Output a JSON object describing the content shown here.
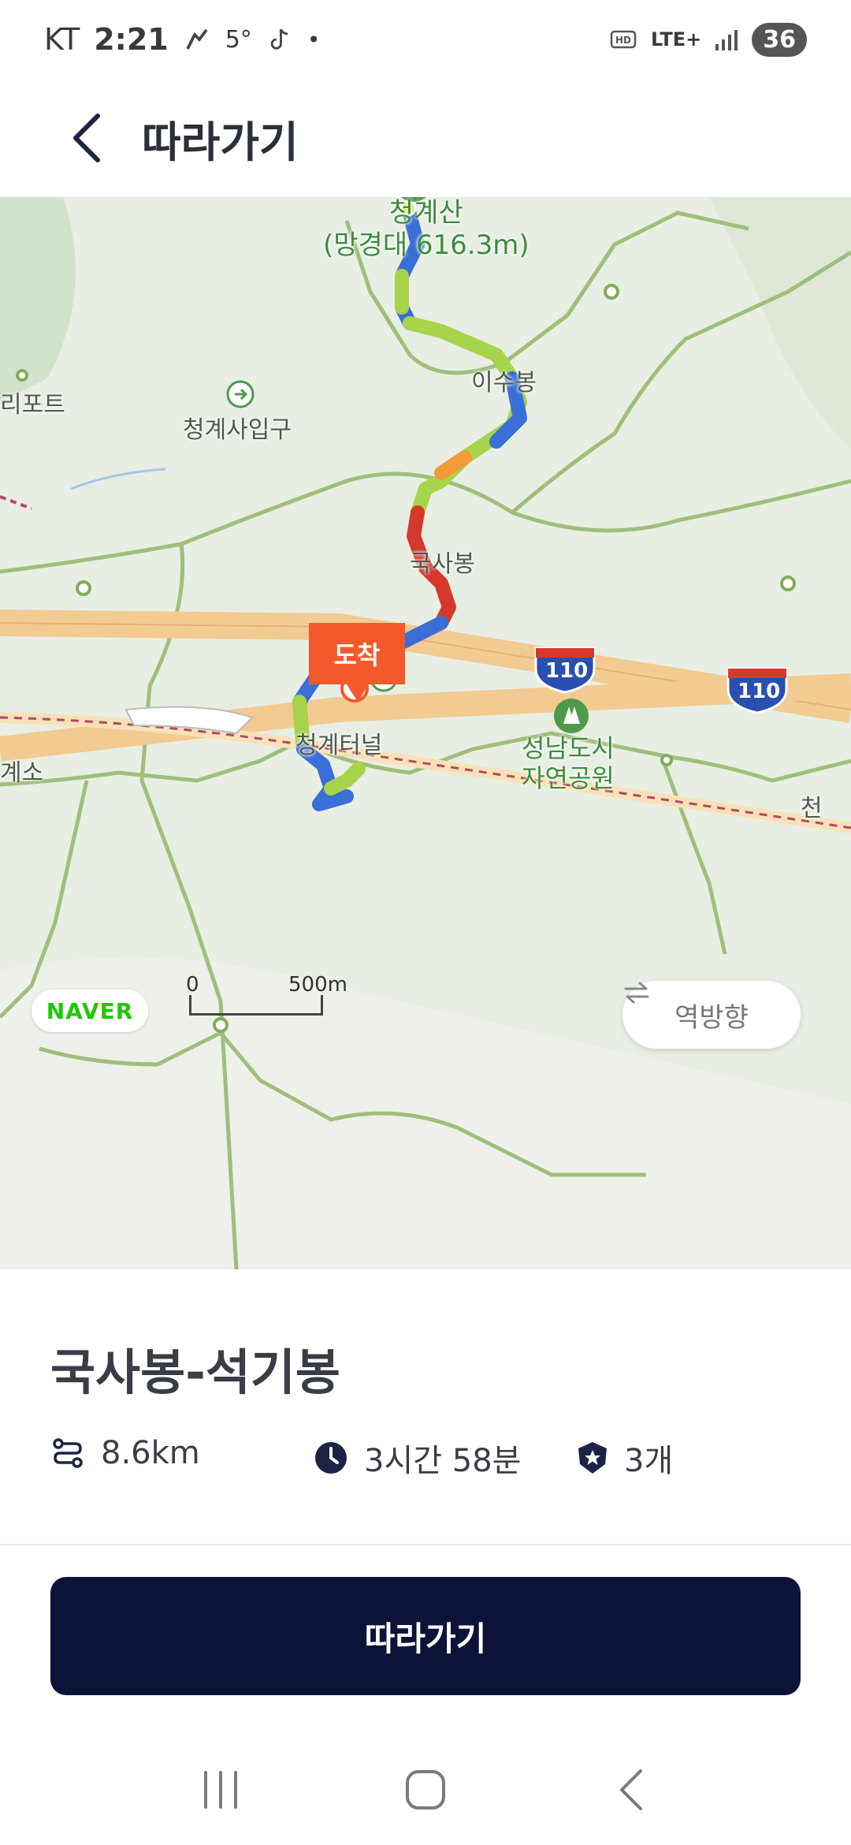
{
  "status_bar": {
    "carrier": "KT",
    "time": "2:21",
    "temperature": "5°",
    "network": "LTE+",
    "battery": "36"
  },
  "header": {
    "title": "따라가기"
  },
  "map": {
    "peak_label_line1": "청계산",
    "peak_label_line2": "(망경대 616.3m)",
    "labels": {
      "resort": "리포트",
      "cheonggyesa": "청계사입구",
      "isubong": "이수봉",
      "guksabong": "국사봉",
      "tunnel": "청계터널",
      "park_line1": "성남도시",
      "park_line2": "자연공원",
      "toll": "계소",
      "edge_right": "천"
    },
    "highway_number": "110",
    "arrive_tag": "도착",
    "logo": "NAVER",
    "scale_zero": "0",
    "scale_distance": "500m",
    "reverse_button": "역방향",
    "colors": {
      "route_blue": "#3b6fd8",
      "route_green": "#a6d44a",
      "route_red": "#d6392b",
      "route_orange": "#f29b38",
      "arrive": "#f25a2b",
      "trail": "#9fbf7a"
    }
  },
  "course": {
    "name": "국사봉-석기봉",
    "distance": "8.6km",
    "duration": "3시간 58분",
    "checkpoints": "3개"
  },
  "follow_button": "따라가기",
  "icons": {
    "back": "chevron-left-icon",
    "route": "route-icon",
    "clock": "clock-icon",
    "badge": "badge-star-icon",
    "reverse": "swap-arrows-icon"
  }
}
